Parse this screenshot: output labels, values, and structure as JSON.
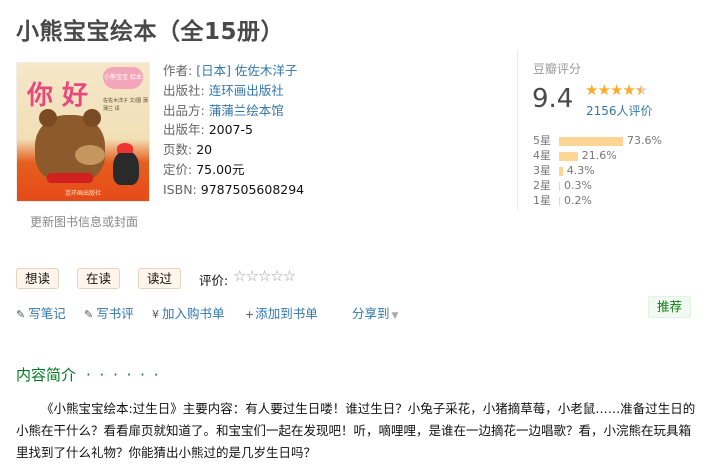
{
  "title": "小熊宝宝绘本（全15册）",
  "cover": {
    "big_text": "你 好",
    "badge": "小熊宝宝 绘本",
    "small_lines": "佐佐木洋子 文/图 蒲蒲兰 译",
    "publisher_mark": "连环画出版社"
  },
  "update_link": "更新图书信息或封面",
  "info": {
    "author_label": "作者:",
    "author": "[日本] 佐佐木洋子",
    "publisher_label": "出版社:",
    "publisher": "连环画出版社",
    "producer_label": "出品方:",
    "producer": "蒲蒲兰绘本馆",
    "year_label": "出版年:",
    "year": "2007-5",
    "pages_label": "页数:",
    "pages": "20",
    "price_label": "定价:",
    "price": "75.00元",
    "isbn_label": "ISBN:",
    "isbn": "9787505608294"
  },
  "rating": {
    "title": "豆瓣评分",
    "score": "9.4",
    "votes": "2156人评价",
    "star_value": 4.5,
    "distribution": [
      {
        "label": "5星",
        "pct": "73.6%",
        "value": 73.6
      },
      {
        "label": "4星",
        "pct": "21.6%",
        "value": 21.6
      },
      {
        "label": "3星",
        "pct": "4.3%",
        "value": 4.3
      },
      {
        "label": "2星",
        "pct": "0.3%",
        "value": 0.3
      },
      {
        "label": "1星",
        "pct": "0.2%",
        "value": 0.2
      }
    ]
  },
  "actions": {
    "want": "想读",
    "reading": "在读",
    "read": "读过",
    "rate_label": "评价:",
    "rate_stars": "☆☆☆☆☆"
  },
  "tools": {
    "note": "写笔记",
    "review": "写书评",
    "cart": "加入购书单",
    "booklist": "添加到书单",
    "share": "分享到",
    "recommend": "推荐"
  },
  "section": {
    "title": "内容简介",
    "dots": "· · · · · ·",
    "summary": "《小熊宝宝绘本:过生日》主要内容：有人要过生日喽！谁过生日？小兔子采花，小猪摘草莓，小老鼠……准备过生日的小熊在干什么？看看扉页就知道了。和宝宝们一起在发现吧！听，嘀哩哩，是谁在一边摘花一边唱歌？看，小浣熊在玩具箱里找到了什么礼物？你能猜出小熊过的是几岁生日吗？"
  },
  "colors": {
    "link": "#3377aa",
    "green": "#007722",
    "star": "#ffac2d",
    "bar": "#ffd596"
  }
}
